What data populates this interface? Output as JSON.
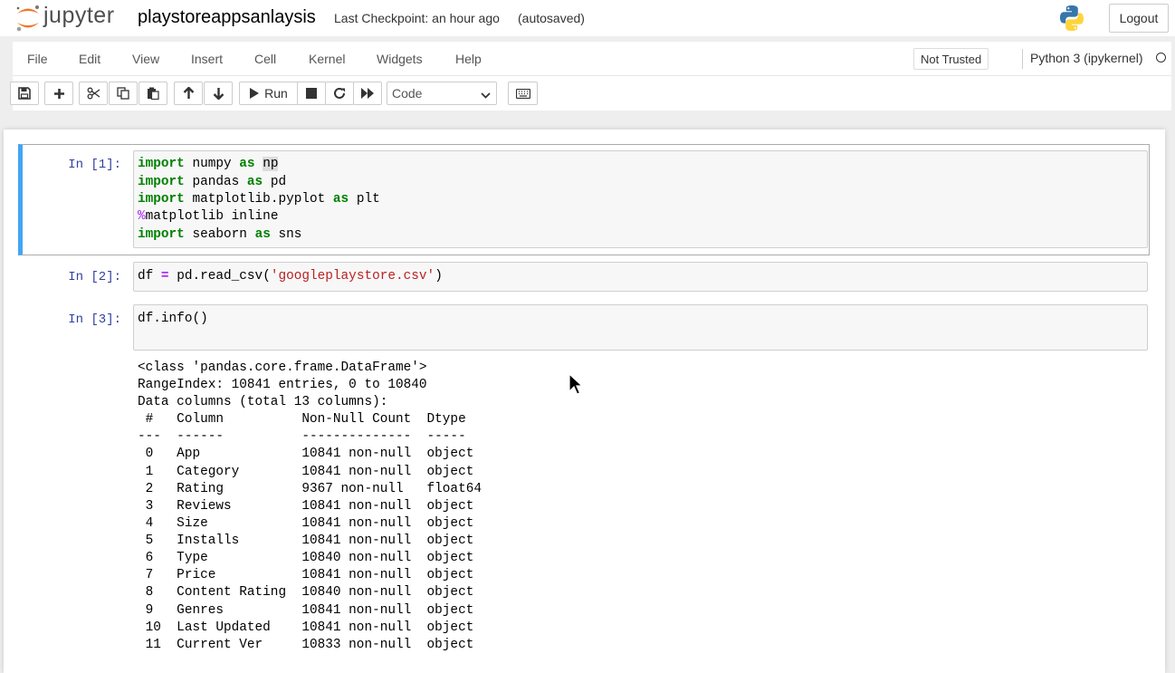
{
  "header": {
    "logo_text": "jupyter",
    "notebook_name": "playstoreappsanlaysis",
    "checkpoint": "Last Checkpoint: an hour ago",
    "autosave": "(autosaved)",
    "logout_label": "Logout"
  },
  "menu": {
    "items": [
      "File",
      "Edit",
      "View",
      "Insert",
      "Cell",
      "Kernel",
      "Widgets",
      "Help"
    ],
    "trust": "Not Trusted",
    "kernel": "Python 3 (ipykernel)"
  },
  "toolbar": {
    "run_label": "Run",
    "cell_type": "Code"
  },
  "cells": [
    {
      "prompt": "In [1]:",
      "lines": [
        "import numpy as np",
        "import pandas as pd",
        "import matplotlib.pyplot as plt",
        "%matplotlib inline",
        "import seaborn as sns"
      ]
    },
    {
      "prompt": "In [2]:",
      "lines": [
        "df = pd.read_csv('googleplaystore.csv')"
      ]
    },
    {
      "prompt": "In [3]:",
      "lines": [
        "df.info()"
      ]
    }
  ],
  "output": {
    "lines": [
      "<class 'pandas.core.frame.DataFrame'>",
      "RangeIndex: 10841 entries, 0 to 10840",
      "Data columns (total 13 columns):",
      " #   Column          Non-Null Count  Dtype  ",
      "---  ------          --------------  -----  ",
      " 0   App             10841 non-null  object ",
      " 1   Category        10841 non-null  object ",
      " 2   Rating          9367 non-null   float64",
      " 3   Reviews         10841 non-null  object ",
      " 4   Size            10841 non-null  object ",
      " 5   Installs        10841 non-null  object ",
      " 6   Type            10840 non-null  object ",
      " 7   Price           10841 non-null  object ",
      " 8   Content Rating  10840 non-null  object ",
      " 9   Genres          10841 non-null  object ",
      " 10  Last Updated    10841 non-null  object ",
      " 11  Current Ver     10833 non-null  object "
    ]
  },
  "colors": {
    "accent": "#42a5f5",
    "prompt": "#303f9f",
    "keyword": "#008000",
    "magic": "#aa22ff",
    "string": "#ba2121"
  }
}
